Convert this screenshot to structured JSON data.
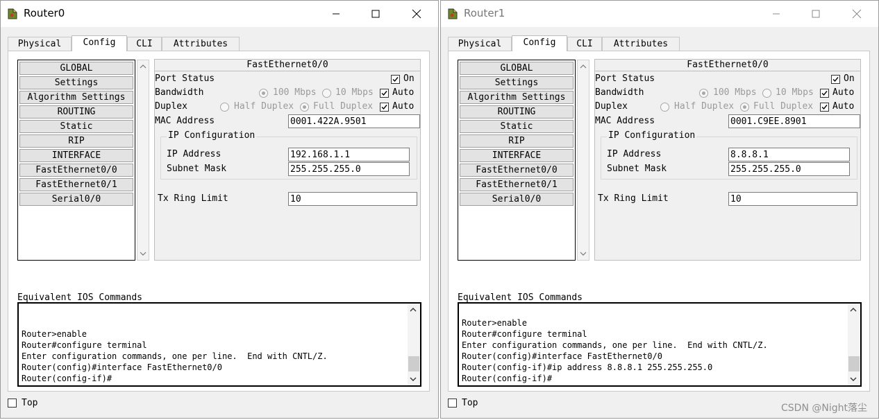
{
  "windows": [
    {
      "title": "Router0",
      "tabs": [
        "Physical",
        "Config",
        "CLI",
        "Attributes"
      ],
      "active_tab": "Config",
      "nav_items": [
        "GLOBAL",
        "Settings",
        "Algorithm Settings",
        "ROUTING",
        "Static",
        "RIP",
        "INTERFACE",
        "FastEthernet0/0",
        "FastEthernet0/1",
        "Serial0/0"
      ],
      "interface": {
        "header": "FastEthernet0/0",
        "port_status_label": "Port Status",
        "port_status_on_label": "On",
        "bandwidth_label": "Bandwidth",
        "bandwidth_100": "100 Mbps",
        "bandwidth_10": "10 Mbps",
        "auto_label": "Auto",
        "duplex_label": "Duplex",
        "half_duplex": "Half Duplex",
        "full_duplex": "Full Duplex",
        "mac_label": "MAC Address",
        "mac_value": "0001.422A.9501",
        "ip_group_title": "IP Configuration",
        "ip_label": "IP Address",
        "ip_value": "192.168.1.1",
        "mask_label": "Subnet Mask",
        "mask_value": "255.255.255.0",
        "tx_label": "Tx Ring Limit",
        "tx_value": "10"
      },
      "ios_label": "Equivalent IOS Commands",
      "terminal_lines": [
        "Router>enable",
        "Router#configure terminal",
        "Enter configuration commands, one per line.  End with CNTL/Z.",
        "Router(config)#interface FastEthernet0/0",
        "Router(config-if)#"
      ],
      "top_label": "Top"
    },
    {
      "title": "Router1",
      "tabs": [
        "Physical",
        "Config",
        "CLI",
        "Attributes"
      ],
      "active_tab": "Config",
      "nav_items": [
        "GLOBAL",
        "Settings",
        "Algorithm Settings",
        "ROUTING",
        "Static",
        "RIP",
        "INTERFACE",
        "FastEthernet0/0",
        "FastEthernet0/1",
        "Serial0/0"
      ],
      "interface": {
        "header": "FastEthernet0/0",
        "port_status_label": "Port Status",
        "port_status_on_label": "On",
        "bandwidth_label": "Bandwidth",
        "bandwidth_100": "100 Mbps",
        "bandwidth_10": "10 Mbps",
        "auto_label": "Auto",
        "duplex_label": "Duplex",
        "half_duplex": "Half Duplex",
        "full_duplex": "Full Duplex",
        "mac_label": "MAC Address",
        "mac_value": "0001.C9EE.8901",
        "ip_group_title": "IP Configuration",
        "ip_label": "IP Address",
        "ip_value": "8.8.8.1",
        "mask_label": "Subnet Mask",
        "mask_value": "255.255.255.0",
        "tx_label": "Tx Ring Limit",
        "tx_value": "10"
      },
      "ios_label": "Equivalent IOS Commands",
      "terminal_lines": [
        "Router>enable",
        "Router#configure terminal",
        "Enter configuration commands, one per line.  End with CNTL/Z.",
        "Router(config)#interface FastEthernet0/0",
        "Router(config-if)#ip address 8.8.8.1 255.255.255.0",
        "Router(config-if)#"
      ],
      "top_label": "Top"
    }
  ],
  "watermark": "CSDN @Night落尘",
  "icons": {
    "router": "router-icon",
    "minimize": "minimize-icon",
    "maximize": "maximize-icon",
    "close": "close-icon",
    "check": "check-icon",
    "scroll_up": "chevron-up-icon",
    "scroll_down": "chevron-down-icon"
  }
}
